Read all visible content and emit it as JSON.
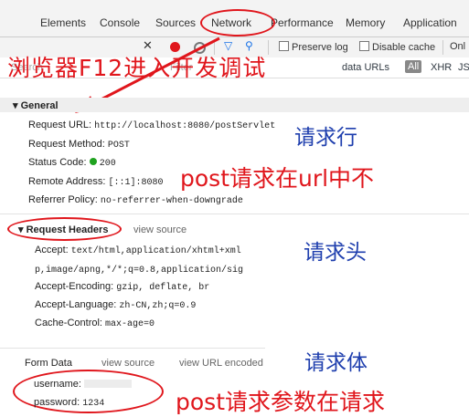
{
  "tabs": [
    {
      "label": "Elements"
    },
    {
      "label": "Console"
    },
    {
      "label": "Sources"
    },
    {
      "label": "Network"
    },
    {
      "label": "Performance"
    },
    {
      "label": "Memory"
    },
    {
      "label": "Application"
    }
  ],
  "toolbar": {
    "preserve_log": "Preserve log",
    "disable_cache": "Disable cache",
    "online_partial": "Onl"
  },
  "filter": {
    "search_placeholder": "Search",
    "filter_placeholder": "Filter",
    "hide_data_urls": "data URLs",
    "all_label": "All",
    "xhr_label": "XHR",
    "js_label": "JS"
  },
  "general": {
    "title": "General",
    "rows": [
      {
        "key": "Request URL:",
        "value": "http://localhost:8080/postServlet"
      },
      {
        "key": "Request Method:",
        "value": "POST"
      },
      {
        "key": "Status Code:",
        "value": "200"
      },
      {
        "key": "Remote Address:",
        "value": "[::1]:8080"
      },
      {
        "key": "Referrer Policy:",
        "value": "no-referrer-when-downgrade"
      }
    ],
    "status_color": "#1fa21f"
  },
  "request_headers": {
    "title": "Request Headers",
    "view_source": "view source",
    "accept_key": "Accept:",
    "accept_line1": "text/html,application/xhtml+xml",
    "accept_line2": "p,image/apng,*/*;q=0.8,application/sig",
    "rows": [
      {
        "key": "Accept-Encoding:",
        "value": "gzip, deflate, br"
      },
      {
        "key": "Accept-Language:",
        "value": "zh-CN,zh;q=0.9"
      },
      {
        "key": "Cache-Control:",
        "value": "max-age=0"
      }
    ]
  },
  "form_data": {
    "title": "Form Data",
    "view_source": "view source",
    "view_url_encoded": "view URL encoded",
    "rows": [
      {
        "key": "username:",
        "value": ""
      },
      {
        "key": "password:",
        "value": "1234"
      }
    ]
  },
  "annotations": {
    "f12": "浏览器F12进入开发调试",
    "request_line": "请求行",
    "post_url": "post请求在url中不",
    "request_head": "请求头",
    "request_body": "请求体",
    "post_params": "post请求参数在请求"
  },
  "colors": {
    "annotation_red": "#e0161c",
    "annotation_blue": "#1f3fae"
  }
}
